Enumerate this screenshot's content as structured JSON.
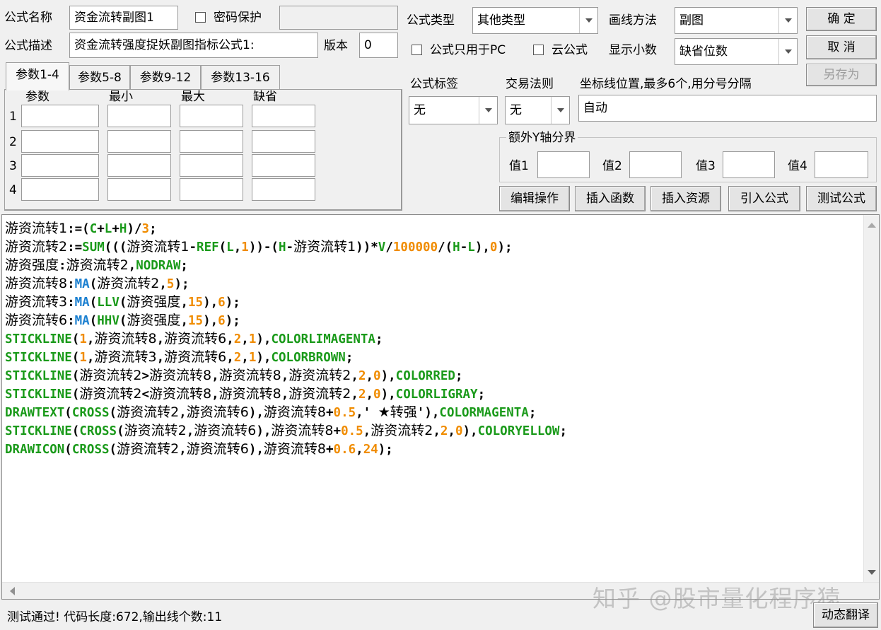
{
  "header": {
    "name_label": "公式名称",
    "name_value": "资金流转副图1",
    "password_label": "密码保护",
    "desc_label": "公式描述",
    "desc_value": "资金流转强度捉妖副图指标公式1:",
    "version_label": "版本",
    "version_value": "0",
    "type_label": "公式类型",
    "type_value": "其他类型",
    "draw_label": "画线方法",
    "draw_value": "副图",
    "pc_only_label": "公式只用于PC",
    "cloud_label": "云公式",
    "decimal_label": "显示小数",
    "decimal_value": "缺省位数"
  },
  "buttons": {
    "ok": "确  定",
    "cancel": "取  消",
    "save_as": "另存为",
    "edit_op": "编辑操作",
    "insert_func": "插入函数",
    "insert_res": "插入资源",
    "import_formula": "引入公式",
    "test_formula": "测试公式",
    "translate": "动态翻译"
  },
  "tabs": [
    "参数1-4",
    "参数5-8",
    "参数9-12",
    "参数13-16"
  ],
  "params": {
    "headers": [
      "参数",
      "最小",
      "最大",
      "缺省"
    ],
    "rows": [
      "1",
      "2",
      "3",
      "4"
    ]
  },
  "formula_tag_label": "公式标签",
  "formula_tag_value": "无",
  "trade_rule_label": "交易法则",
  "trade_rule_value": "无",
  "axis_label": "坐标线位置,最多6个,用分号分隔",
  "axis_value": "自动",
  "extra_y": {
    "legend": "额外Y轴分界",
    "labels": [
      "值1",
      "值2",
      "值3",
      "值4"
    ]
  },
  "code_lines": [
    [
      [
        "v",
        "游资流转1"
      ],
      [
        "k",
        ":=("
      ],
      [
        "g",
        "C"
      ],
      [
        "k",
        "+"
      ],
      [
        "g",
        "L"
      ],
      [
        "k",
        "+"
      ],
      [
        "g",
        "H"
      ],
      [
        "k",
        ")/"
      ],
      [
        "o",
        "3"
      ],
      [
        "k",
        ";"
      ]
    ],
    [
      [
        "v",
        "游资流转2"
      ],
      [
        "k",
        ":="
      ],
      [
        "g",
        "SUM"
      ],
      [
        "k",
        "((("
      ],
      [
        "v",
        "游资流转1"
      ],
      [
        "k",
        "-"
      ],
      [
        "g",
        "REF"
      ],
      [
        "k",
        "("
      ],
      [
        "g",
        "L"
      ],
      [
        "k",
        ","
      ],
      [
        "o",
        "1"
      ],
      [
        "k",
        "))-("
      ],
      [
        "g",
        "H"
      ],
      [
        "k",
        "-"
      ],
      [
        "v",
        "游资流转1"
      ],
      [
        "k",
        "))*"
      ],
      [
        "g",
        "V"
      ],
      [
        "k",
        "/"
      ],
      [
        "o",
        "100000"
      ],
      [
        "k",
        "/("
      ],
      [
        "g",
        "H"
      ],
      [
        "k",
        "-"
      ],
      [
        "g",
        "L"
      ],
      [
        "k",
        "),"
      ],
      [
        "o",
        "0"
      ],
      [
        "k",
        ");"
      ]
    ],
    [
      [
        "v",
        "游资强度"
      ],
      [
        "k",
        ":"
      ],
      [
        "v",
        "游资流转2"
      ],
      [
        "k",
        ","
      ],
      [
        "g",
        "NODRAW"
      ],
      [
        "k",
        ";"
      ]
    ],
    [
      [
        "v",
        "游资流转8"
      ],
      [
        "k",
        ":"
      ],
      [
        "b",
        "MA"
      ],
      [
        "k",
        "("
      ],
      [
        "v",
        "游资流转2"
      ],
      [
        "k",
        ","
      ],
      [
        "o",
        "5"
      ],
      [
        "k",
        ");"
      ]
    ],
    [
      [
        "v",
        "游资流转3"
      ],
      [
        "k",
        ":"
      ],
      [
        "b",
        "MA"
      ],
      [
        "k",
        "("
      ],
      [
        "g",
        "LLV"
      ],
      [
        "k",
        "("
      ],
      [
        "v",
        "游资强度"
      ],
      [
        "k",
        ","
      ],
      [
        "o",
        "15"
      ],
      [
        "k",
        "),"
      ],
      [
        "o",
        "6"
      ],
      [
        "k",
        ");"
      ]
    ],
    [
      [
        "v",
        "游资流转6"
      ],
      [
        "k",
        ":"
      ],
      [
        "b",
        "MA"
      ],
      [
        "k",
        "("
      ],
      [
        "g",
        "HHV"
      ],
      [
        "k",
        "("
      ],
      [
        "v",
        "游资强度"
      ],
      [
        "k",
        ","
      ],
      [
        "o",
        "15"
      ],
      [
        "k",
        "),"
      ],
      [
        "o",
        "6"
      ],
      [
        "k",
        ");"
      ]
    ],
    [
      [
        "g",
        "STICKLINE"
      ],
      [
        "k",
        "("
      ],
      [
        "o",
        "1"
      ],
      [
        "k",
        ","
      ],
      [
        "v",
        "游资流转8"
      ],
      [
        "k",
        ","
      ],
      [
        "v",
        "游资流转6"
      ],
      [
        "k",
        ","
      ],
      [
        "o",
        "2"
      ],
      [
        "k",
        ","
      ],
      [
        "o",
        "1"
      ],
      [
        "k",
        "),"
      ],
      [
        "g",
        "COLORLIMAGENTA"
      ],
      [
        "k",
        ";"
      ]
    ],
    [
      [
        "g",
        "STICKLINE"
      ],
      [
        "k",
        "("
      ],
      [
        "o",
        "1"
      ],
      [
        "k",
        ","
      ],
      [
        "v",
        "游资流转3"
      ],
      [
        "k",
        ","
      ],
      [
        "v",
        "游资流转6"
      ],
      [
        "k",
        ","
      ],
      [
        "o",
        "2"
      ],
      [
        "k",
        ","
      ],
      [
        "o",
        "1"
      ],
      [
        "k",
        "),"
      ],
      [
        "g",
        "COLORBROWN"
      ],
      [
        "k",
        ";"
      ]
    ],
    [
      [
        "g",
        "STICKLINE"
      ],
      [
        "k",
        "("
      ],
      [
        "v",
        "游资流转2"
      ],
      [
        "k",
        ">"
      ],
      [
        "v",
        "游资流转8"
      ],
      [
        "k",
        ","
      ],
      [
        "v",
        "游资流转8"
      ],
      [
        "k",
        ","
      ],
      [
        "v",
        "游资流转2"
      ],
      [
        "k",
        ","
      ],
      [
        "o",
        "2"
      ],
      [
        "k",
        ","
      ],
      [
        "o",
        "0"
      ],
      [
        "k",
        "),"
      ],
      [
        "g",
        "COLORRED"
      ],
      [
        "k",
        ";"
      ]
    ],
    [
      [
        "g",
        "STICKLINE"
      ],
      [
        "k",
        "("
      ],
      [
        "v",
        "游资流转2"
      ],
      [
        "k",
        "<"
      ],
      [
        "v",
        "游资流转8"
      ],
      [
        "k",
        ","
      ],
      [
        "v",
        "游资流转8"
      ],
      [
        "k",
        ","
      ],
      [
        "v",
        "游资流转2"
      ],
      [
        "k",
        ","
      ],
      [
        "o",
        "2"
      ],
      [
        "k",
        ","
      ],
      [
        "o",
        "0"
      ],
      [
        "k",
        "),"
      ],
      [
        "g",
        "COLORLIGRAY"
      ],
      [
        "k",
        ";"
      ]
    ],
    [
      [
        "g",
        "DRAWTEXT"
      ],
      [
        "k",
        "("
      ],
      [
        "g",
        "CROSS"
      ],
      [
        "k",
        "("
      ],
      [
        "v",
        "游资流转2"
      ],
      [
        "k",
        ","
      ],
      [
        "v",
        "游资流转6"
      ],
      [
        "k",
        "),"
      ],
      [
        "v",
        "游资流转8"
      ],
      [
        "k",
        "+"
      ],
      [
        "o",
        "0.5"
      ],
      [
        "k",
        ",' "
      ],
      [
        "v",
        "★转强"
      ],
      [
        "k",
        "'),"
      ],
      [
        "g",
        "COLORMAGENTA"
      ],
      [
        "k",
        ";"
      ]
    ],
    [
      [
        "g",
        "STICKLINE"
      ],
      [
        "k",
        "("
      ],
      [
        "g",
        "CROSS"
      ],
      [
        "k",
        "("
      ],
      [
        "v",
        "游资流转2"
      ],
      [
        "k",
        ","
      ],
      [
        "v",
        "游资流转6"
      ],
      [
        "k",
        "),"
      ],
      [
        "v",
        "游资流转8"
      ],
      [
        "k",
        "+"
      ],
      [
        "o",
        "0.5"
      ],
      [
        "k",
        ","
      ],
      [
        "v",
        "游资流转2"
      ],
      [
        "k",
        ","
      ],
      [
        "o",
        "2"
      ],
      [
        "k",
        ","
      ],
      [
        "o",
        "0"
      ],
      [
        "k",
        "),"
      ],
      [
        "g",
        "COLORYELLOW"
      ],
      [
        "k",
        ";"
      ]
    ],
    [
      [
        "g",
        "DRAWICON"
      ],
      [
        "k",
        "("
      ],
      [
        "g",
        "CROSS"
      ],
      [
        "k",
        "("
      ],
      [
        "v",
        "游资流转2"
      ],
      [
        "k",
        ","
      ],
      [
        "v",
        "游资流转6"
      ],
      [
        "k",
        "),"
      ],
      [
        "v",
        "游资流转8"
      ],
      [
        "k",
        "+"
      ],
      [
        "o",
        "0.6"
      ],
      [
        "k",
        ","
      ],
      [
        "o",
        "24"
      ],
      [
        "k",
        ");"
      ]
    ]
  ],
  "watermark": "知乎 @股市量化程序猿",
  "status_text": "测试通过! 代码长度:672,输出线个数:11",
  "icons": {
    "dropdown": "chevron-down-icon",
    "scroll_up": "triangle-up-icon",
    "scroll_down": "triangle-down-icon",
    "scroll_left": "triangle-left-icon"
  }
}
